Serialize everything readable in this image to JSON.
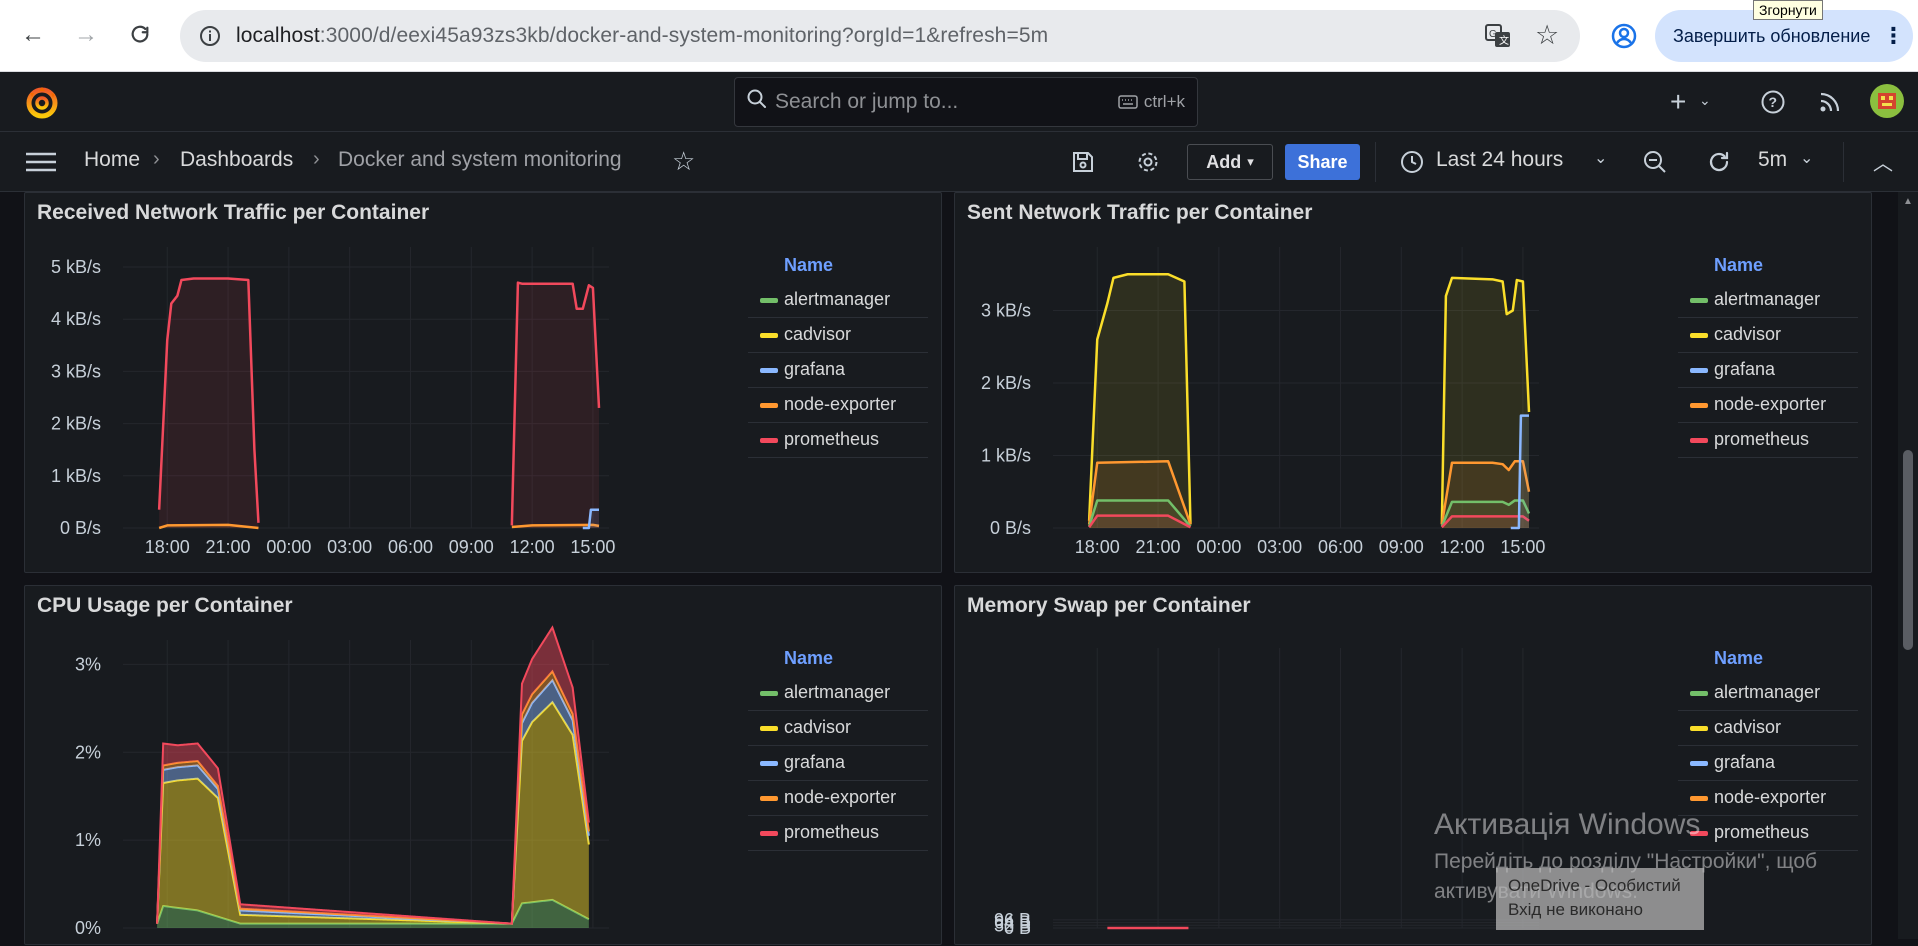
{
  "browser": {
    "url_host": "localhost",
    "url_path": ":3000/d/eexi45a93zs3kb/docker-and-system-monitoring?orgId=1&refresh=5m",
    "update_button": "Завершить обновление",
    "tooltip": "Згорнути"
  },
  "grafana": {
    "search_placeholder": "Search or jump to...",
    "search_shortcut": "ctrl+k",
    "breadcrumbs": [
      "Home",
      "Dashboards",
      "Docker and system monitoring"
    ],
    "add_label": "Add",
    "share_label": "Share",
    "time_range": "Last 24 hours",
    "refresh_interval": "5m"
  },
  "legend": {
    "header": "Name",
    "series": [
      {
        "name": "alertmanager",
        "color": "#73bf69"
      },
      {
        "name": "cadvisor",
        "color": "#fade2a"
      },
      {
        "name": "grafana",
        "color": "#8ab8ff"
      },
      {
        "name": "node-exporter",
        "color": "#ff9830"
      },
      {
        "name": "prometheus",
        "color": "#f2495c"
      }
    ]
  },
  "panels": {
    "received": {
      "title": "Received Network Traffic per Container"
    },
    "sent": {
      "title": "Sent Network Traffic per Container"
    },
    "cpu": {
      "title": "CPU Usage per Container"
    },
    "swap": {
      "title": "Memory Swap per Container"
    }
  },
  "chart_data": [
    {
      "type": "line",
      "title": "Received Network Traffic per Container",
      "x_ticks": [
        "18:00",
        "21:00",
        "00:00",
        "03:00",
        "06:00",
        "09:00",
        "12:00",
        "15:00"
      ],
      "y_ticks": [
        "0 B/s",
        "1 kB/s",
        "2 kB/s",
        "3 kB/s",
        "4 kB/s",
        "5 kB/s"
      ],
      "ylim": [
        0,
        5
      ],
      "x_unit": "hours",
      "xlim": [
        17.1,
        39.3
      ],
      "series": [
        {
          "name": "prometheus",
          "x": [
            17.6,
            18.0,
            18.2,
            18.5,
            18.7,
            19.3,
            21.0,
            22.0,
            22.3,
            22.5,
            35.0,
            35.3,
            35.5,
            37.0,
            38.0,
            38.2,
            38.5,
            38.8,
            39.0,
            39.3
          ],
          "y": [
            0.35,
            3.6,
            4.3,
            4.45,
            4.75,
            4.78,
            4.78,
            4.75,
            1.5,
            0.1,
            0.05,
            4.7,
            4.68,
            4.68,
            4.68,
            4.2,
            4.2,
            4.65,
            4.6,
            2.3
          ]
        },
        {
          "name": "node-exporter",
          "x": [
            17.6,
            18.0,
            21.0,
            22.5,
            35.0,
            36.0,
            39.0,
            39.3
          ],
          "y": [
            0.0,
            0.05,
            0.06,
            0.0,
            0.02,
            0.05,
            0.06,
            0.04
          ]
        },
        {
          "name": "grafana",
          "x": [
            38.5,
            38.8,
            38.9,
            39.3
          ],
          "y": [
            0.0,
            0.0,
            0.35,
            0.35
          ]
        }
      ]
    },
    {
      "type": "line",
      "title": "Sent Network Traffic per Container",
      "x_ticks": [
        "18:00",
        "21:00",
        "00:00",
        "03:00",
        "06:00",
        "09:00",
        "12:00",
        "15:00"
      ],
      "y_ticks": [
        "0 B/s",
        "1 kB/s",
        "2 kB/s",
        "3 kB/s"
      ],
      "ylim": [
        0,
        3.6
      ],
      "x_unit": "hours",
      "xlim": [
        17.1,
        39.3
      ],
      "series": [
        {
          "name": "cadvisor",
          "x": [
            17.6,
            18.0,
            18.2,
            18.5,
            18.8,
            19.5,
            21.5,
            22.3,
            22.6,
            35.0,
            35.2,
            35.5,
            37.5,
            38.0,
            38.2,
            38.5,
            38.7,
            39.0,
            39.3
          ],
          "y": [
            0.1,
            2.6,
            2.8,
            3.1,
            3.45,
            3.5,
            3.5,
            3.4,
            0.05,
            0.05,
            3.2,
            3.45,
            3.43,
            3.4,
            2.95,
            3.0,
            3.42,
            3.4,
            1.6
          ]
        },
        {
          "name": "node-exporter",
          "x": [
            17.6,
            18.0,
            21.5,
            22.6,
            35.0,
            35.5,
            37.5,
            38.0,
            38.3,
            38.6,
            39.0,
            39.3
          ],
          "y": [
            0.05,
            0.9,
            0.92,
            0.05,
            0.05,
            0.9,
            0.9,
            0.88,
            0.8,
            0.92,
            0.92,
            0.5
          ]
        },
        {
          "name": "alertmanager",
          "x": [
            17.6,
            18.0,
            21.5,
            22.6,
            35.0,
            35.5,
            38.0,
            38.3,
            38.6,
            39.0,
            39.3
          ],
          "y": [
            0.02,
            0.38,
            0.38,
            0.02,
            0.02,
            0.36,
            0.36,
            0.32,
            0.38,
            0.38,
            0.2
          ]
        },
        {
          "name": "prometheus",
          "x": [
            17.6,
            18.0,
            21.5,
            22.6,
            35.0,
            35.5,
            39.0,
            39.3
          ],
          "y": [
            0.01,
            0.17,
            0.17,
            0.01,
            0.01,
            0.16,
            0.16,
            0.1
          ]
        },
        {
          "name": "grafana",
          "x": [
            38.4,
            38.8,
            38.9,
            39.3
          ],
          "y": [
            0.0,
            0.0,
            1.55,
            1.55
          ]
        }
      ]
    },
    {
      "type": "area",
      "title": "CPU Usage per Container",
      "stacked": true,
      "y_ticks": [
        "0%",
        "1%",
        "2%",
        "3%"
      ],
      "ylim": [
        0,
        3.05
      ],
      "x_unit": "hours",
      "xlim": [
        17.1,
        39.3
      ],
      "series": [
        {
          "name": "alertmanager",
          "x": [
            17.5,
            17.8,
            19.5,
            21.6,
            35.0,
            35.5,
            37.0,
            38.8
          ],
          "y": [
            0.05,
            0.25,
            0.2,
            0.05,
            0.05,
            0.28,
            0.32,
            0.1
          ]
        },
        {
          "name": "cadvisor",
          "x": [
            17.5,
            17.8,
            18.5,
            19.5,
            20.5,
            21.6,
            35.0,
            35.5,
            36.0,
            37.0,
            38.0,
            38.8
          ],
          "y": [
            0.0,
            1.4,
            1.45,
            1.5,
            1.35,
            0.1,
            0.0,
            1.85,
            2.05,
            2.25,
            2.0,
            0.85
          ]
        },
        {
          "name": "grafana",
          "x": [
            17.5,
            17.8,
            19.5,
            21.6,
            35.0,
            35.5,
            37.0,
            38.8
          ],
          "y": [
            0.0,
            0.15,
            0.15,
            0.05,
            0.0,
            0.2,
            0.25,
            0.1
          ]
        },
        {
          "name": "node-exporter",
          "x": [
            17.5,
            17.8,
            19.5,
            21.6,
            35.0,
            35.5,
            37.0,
            38.8
          ],
          "y": [
            0.0,
            0.05,
            0.05,
            0.02,
            0.0,
            0.1,
            0.1,
            0.05
          ]
        },
        {
          "name": "prometheus",
          "x": [
            17.5,
            17.8,
            18.5,
            19.5,
            20.5,
            21.6,
            35.0,
            35.5,
            36.5,
            37.0,
            38.0,
            38.8
          ],
          "y": [
            0.0,
            0.25,
            0.2,
            0.2,
            0.2,
            0.05,
            0.0,
            0.35,
            0.45,
            0.5,
            0.3,
            0.1
          ]
        }
      ]
    },
    {
      "type": "line",
      "title": "Memory Swap per Container",
      "y_ticks": [
        "0 B",
        "32 B",
        "64 B",
        "96 B"
      ],
      "ylim": [
        0,
        96
      ],
      "x_unit": "hours",
      "xlim": [
        17.1,
        39.3
      ],
      "series": [
        {
          "name": "prometheus",
          "x": [
            18.5,
            22.5
          ],
          "y": [
            0,
            0
          ]
        }
      ]
    }
  ],
  "overlay": {
    "win_title": "Активація Windows",
    "win_line1": "Перейдіть до розділу \"Настройки\", щоб",
    "win_line2": "активувати Windows.",
    "onedrive_line1": "OneDrive - Особистий",
    "onedrive_line2": "Вхід не виконано"
  }
}
